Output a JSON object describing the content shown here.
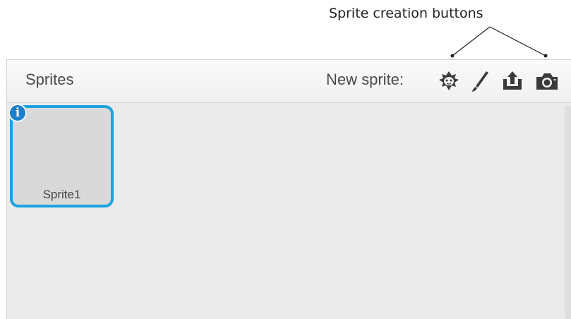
{
  "annotation": {
    "label": "Sprite creation buttons"
  },
  "sprites_pane": {
    "title": "Sprites",
    "new_sprite_label": "New sprite:",
    "buttons": [
      {
        "icon": "sprite-library-icon"
      },
      {
        "icon": "paintbrush-icon"
      },
      {
        "icon": "upload-icon"
      },
      {
        "icon": "camera-icon"
      }
    ],
    "sprites": [
      {
        "name": "Sprite1",
        "selected": true,
        "info_badge": "i"
      }
    ]
  },
  "colors": {
    "selection_border": "#1aa3e0",
    "info_badge": "#1a7fcc",
    "pane_background": "#ebebeb"
  }
}
